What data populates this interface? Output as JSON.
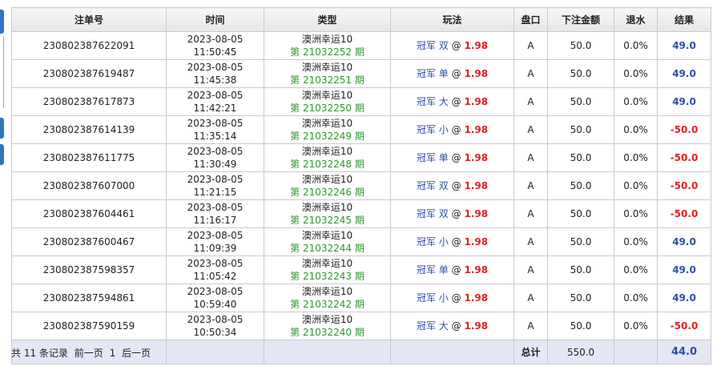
{
  "table": {
    "headers": {
      "id": "注单号",
      "time": "时间",
      "type": "类型",
      "play": "玩法",
      "market": "盘口",
      "amount": "下注金额",
      "rebate": "退水",
      "result": "结果"
    },
    "rows": [
      {
        "id": "230802387622091",
        "date": "2023-08-05",
        "time": "11:50:45",
        "game": "澳洲幸运10",
        "period": "第 21032252 期",
        "play": "冠军 双",
        "at": "@",
        "odds": "1.98",
        "market": "A",
        "amount": "50.0",
        "rebate": "0.0%",
        "result": "49.0",
        "win": true
      },
      {
        "id": "230802387619487",
        "date": "2023-08-05",
        "time": "11:45:38",
        "game": "澳洲幸运10",
        "period": "第 21032251 期",
        "play": "冠军 单",
        "at": "@",
        "odds": "1.98",
        "market": "A",
        "amount": "50.0",
        "rebate": "0.0%",
        "result": "49.0",
        "win": true
      },
      {
        "id": "230802387617873",
        "date": "2023-08-05",
        "time": "11:42:21",
        "game": "澳洲幸运10",
        "period": "第 21032250 期",
        "play": "冠军 大",
        "at": "@",
        "odds": "1.98",
        "market": "A",
        "amount": "50.0",
        "rebate": "0.0%",
        "result": "49.0",
        "win": true
      },
      {
        "id": "230802387614139",
        "date": "2023-08-05",
        "time": "11:35:14",
        "game": "澳洲幸运10",
        "period": "第 21032249 期",
        "play": "冠军 小",
        "at": "@",
        "odds": "1.98",
        "market": "A",
        "amount": "50.0",
        "rebate": "0.0%",
        "result": "-50.0",
        "win": false
      },
      {
        "id": "230802387611775",
        "date": "2023-08-05",
        "time": "11:30:49",
        "game": "澳洲幸运10",
        "period": "第 21032248 期",
        "play": "冠军 单",
        "at": "@",
        "odds": "1.98",
        "market": "A",
        "amount": "50.0",
        "rebate": "0.0%",
        "result": "-50.0",
        "win": false
      },
      {
        "id": "230802387607000",
        "date": "2023-08-05",
        "time": "11:21:15",
        "game": "澳洲幸运10",
        "period": "第 21032246 期",
        "play": "冠军 双",
        "at": "@",
        "odds": "1.98",
        "market": "A",
        "amount": "50.0",
        "rebate": "0.0%",
        "result": "-50.0",
        "win": false
      },
      {
        "id": "230802387604461",
        "date": "2023-08-05",
        "time": "11:16:17",
        "game": "澳洲幸运10",
        "period": "第 21032245 期",
        "play": "冠军 双",
        "at": "@",
        "odds": "1.98",
        "market": "A",
        "amount": "50.0",
        "rebate": "0.0%",
        "result": "-50.0",
        "win": false
      },
      {
        "id": "230802387600467",
        "date": "2023-08-05",
        "time": "11:09:39",
        "game": "澳洲幸运10",
        "period": "第 21032244 期",
        "play": "冠军 小",
        "at": "@",
        "odds": "1.98",
        "market": "A",
        "amount": "50.0",
        "rebate": "0.0%",
        "result": "49.0",
        "win": true
      },
      {
        "id": "230802387598357",
        "date": "2023-08-05",
        "time": "11:05:42",
        "game": "澳洲幸运10",
        "period": "第 21032243 期",
        "play": "冠军 单",
        "at": "@",
        "odds": "1.98",
        "market": "A",
        "amount": "50.0",
        "rebate": "0.0%",
        "result": "49.0",
        "win": true
      },
      {
        "id": "230802387594861",
        "date": "2023-08-05",
        "time": "10:59:40",
        "game": "澳洲幸运10",
        "period": "第 21032242 期",
        "play": "冠军 小",
        "at": "@",
        "odds": "1.98",
        "market": "A",
        "amount": "50.0",
        "rebate": "0.0%",
        "result": "49.0",
        "win": true
      },
      {
        "id": "230802387590159",
        "date": "2023-08-05",
        "time": "10:50:34",
        "game": "澳洲幸运10",
        "period": "第 21032240 期",
        "play": "冠军 大",
        "at": "@",
        "odds": "1.98",
        "market": "A",
        "amount": "50.0",
        "rebate": "0.0%",
        "result": "-50.0",
        "win": false
      }
    ],
    "total": {
      "label": "总计",
      "amount": "550.0",
      "result": "44.0"
    }
  },
  "pager": {
    "summary": "共 11 条记录",
    "prev": "前一页",
    "page": "1",
    "next": "后一页"
  },
  "colors": {
    "win": "#2c4fa8",
    "loss": "#e02020",
    "period": "#2a9a2a",
    "total_bg": "#e4e7f5",
    "tab": "#2f73c4"
  }
}
